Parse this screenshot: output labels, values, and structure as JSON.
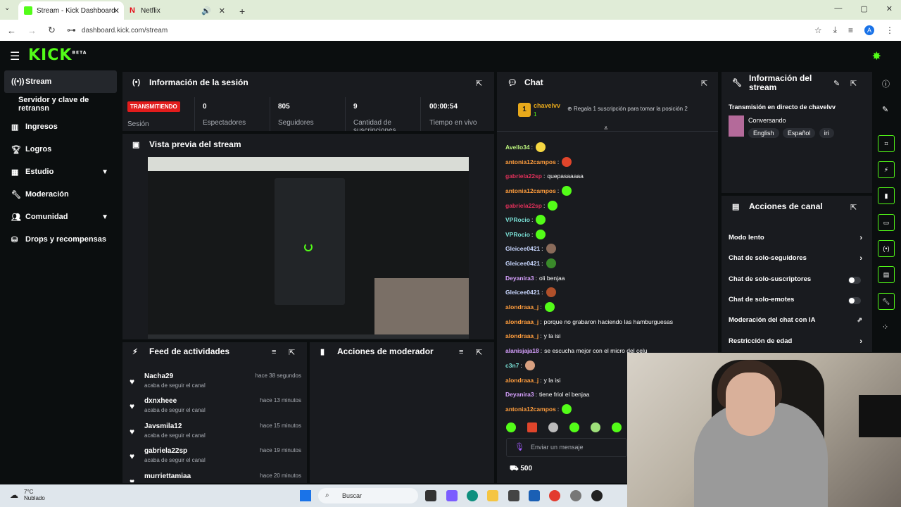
{
  "browser": {
    "tabs": [
      {
        "title": "Stream - Kick Dashboard",
        "active": true
      },
      {
        "title": "Netflix",
        "active": false
      }
    ],
    "url": "dashboard.kick.com/stream",
    "profile_initial": "A"
  },
  "app": {
    "logo": "KICK",
    "logo_badge": "BETA"
  },
  "sidebar": {
    "items": [
      {
        "label": "Stream",
        "icon": "stream-icon",
        "active": true
      },
      {
        "label": "Servidor y clave de retransn",
        "icon": "",
        "active": false
      },
      {
        "label": "Ingresos",
        "icon": "chart-icon",
        "active": false
      },
      {
        "label": "Logros",
        "icon": "trophy-icon",
        "active": false
      },
      {
        "label": "Estudio",
        "icon": "grid-icon",
        "active": false,
        "expandable": true
      },
      {
        "label": "Moderación",
        "icon": "wrench-icon",
        "active": false
      },
      {
        "label": "Comunidad",
        "icon": "people-icon",
        "active": false,
        "expandable": true
      },
      {
        "label": "Drops y recompensas",
        "icon": "gift-icon",
        "active": false
      }
    ]
  },
  "session": {
    "title": "Información de la sesión",
    "status_badge": "TRANSMITIENDO",
    "status_label": "Sesión",
    "stats": [
      {
        "value": "0",
        "label": "Espectadores"
      },
      {
        "value": "805",
        "label": "Seguidores"
      },
      {
        "value": "9",
        "label": "Cantidad de suscripciones"
      },
      {
        "value": "00:00:54",
        "label": "Tiempo en vivo"
      }
    ]
  },
  "preview": {
    "title": "Vista previa del stream"
  },
  "feed": {
    "title": "Feed de actividades",
    "items": [
      {
        "name": "Nacha29",
        "desc": "acaba de seguir el canal",
        "time": "hace 38 segundos"
      },
      {
        "name": "dxnxheee",
        "desc": "acaba de seguir el canal",
        "time": "hace 13 minutos"
      },
      {
        "name": "Javsmila12",
        "desc": "acaba de seguir el canal",
        "time": "hace 15 minutos"
      },
      {
        "name": "gabriela22sp",
        "desc": "acaba de seguir el canal",
        "time": "hace 19 minutos"
      },
      {
        "name": "murriettamiaa",
        "desc": "",
        "time": "hace 20 minutos"
      }
    ]
  },
  "mod_actions": {
    "title": "Acciones de moderador"
  },
  "chat": {
    "title": "Chat",
    "top_gifter": "chavelvv",
    "top_gifter_rank": "1",
    "top_gifter_count": "1",
    "gift_prompt": "Regala 1 suscripción para tomar la posición 2",
    "messages": [
      {
        "user": "Avello34",
        "color": "#b9f27c",
        "text": "",
        "emote": "#f5d742"
      },
      {
        "user": "antonia12campos",
        "color": "#ff9d3d",
        "text": "",
        "emote": "#e0452b"
      },
      {
        "user": "gabriela22sp",
        "color": "#e0305a",
        "text": "quepasaaaaa",
        "emote": ""
      },
      {
        "user": "antonia12campos",
        "color": "#ff9d3d",
        "text": "",
        "emote": "#53fc18"
      },
      {
        "user": "gabriela22sp",
        "color": "#e0305a",
        "text": "",
        "emote": "#53fc18"
      },
      {
        "user": "VPRocio",
        "color": "#7ae0d6",
        "text": "",
        "emote": "#53fc18"
      },
      {
        "user": "VPRocio",
        "color": "#7ae0d6",
        "text": "",
        "emote": "#53fc18"
      },
      {
        "user": "Gleicee0421",
        "color": "#c9d7ff",
        "text": "",
        "emote": "#8a6b5a"
      },
      {
        "user": "Gleicee0421",
        "color": "#c9d7ff",
        "text": "",
        "emote": "#3a8a2a"
      },
      {
        "user": "Deyanira3",
        "color": "#d7a1ff",
        "text": "oli benjaa",
        "emote": ""
      },
      {
        "user": "Gleicee0421",
        "color": "#c9d7ff",
        "text": "",
        "emote": "#b0502a"
      },
      {
        "user": "alondraaa_j",
        "color": "#ff9d3d",
        "text": "",
        "emote": "#53fc18"
      },
      {
        "user": "alondraaa_j",
        "color": "#ff9d3d",
        "text": "porque no grabaron haciendo las hamburguesas",
        "emote": ""
      },
      {
        "user": "alondraaa_j",
        "color": "#ff9d3d",
        "text": "y la isi",
        "emote": ""
      },
      {
        "user": "alanisjaja18",
        "color": "#d7a1ff",
        "text": "se escucha mejor con el micro del celu",
        "emote": ""
      },
      {
        "user": "c3n7",
        "color": "#7ae0d6",
        "text": "",
        "emote": "#d8a080"
      },
      {
        "user": "alondraaa_j",
        "color": "#ff9d3d",
        "text": "y la isi",
        "emote": ""
      },
      {
        "user": "Deyanira3",
        "color": "#d7a1ff",
        "text": "tiene friol el benjaa",
        "emote": ""
      },
      {
        "user": "antonia12campos",
        "color": "#ff9d3d",
        "text": "",
        "emote": "#53fc18"
      }
    ],
    "input_placeholder": "Enviar un mensaje",
    "points": "500"
  },
  "stream_info": {
    "title": "Información del stream",
    "stream_title": "Transmisión en directo de chavelvv",
    "category": "Conversando",
    "tags": [
      "English",
      "Español",
      "iri"
    ]
  },
  "channel_actions": {
    "title": "Acciones de canal",
    "items": [
      {
        "label": "Modo lento",
        "control": "chevron"
      },
      {
        "label": "Chat de solo-seguidores",
        "control": "chevron"
      },
      {
        "label": "Chat de solo-suscriptores",
        "control": "toggle"
      },
      {
        "label": "Chat de solo-emotes",
        "control": "toggle"
      },
      {
        "label": "Moderación del chat con IA",
        "control": "external"
      },
      {
        "label": "Restricción de edad",
        "control": "chevron"
      }
    ]
  },
  "taskbar": {
    "weather_temp": "7°C",
    "weather_desc": "Nublado",
    "search_placeholder": "Buscar"
  },
  "colors": {
    "brand": "#53fc18",
    "panel": "#191b1f",
    "background": "#0b0e0f",
    "live": "#e21c1c"
  }
}
